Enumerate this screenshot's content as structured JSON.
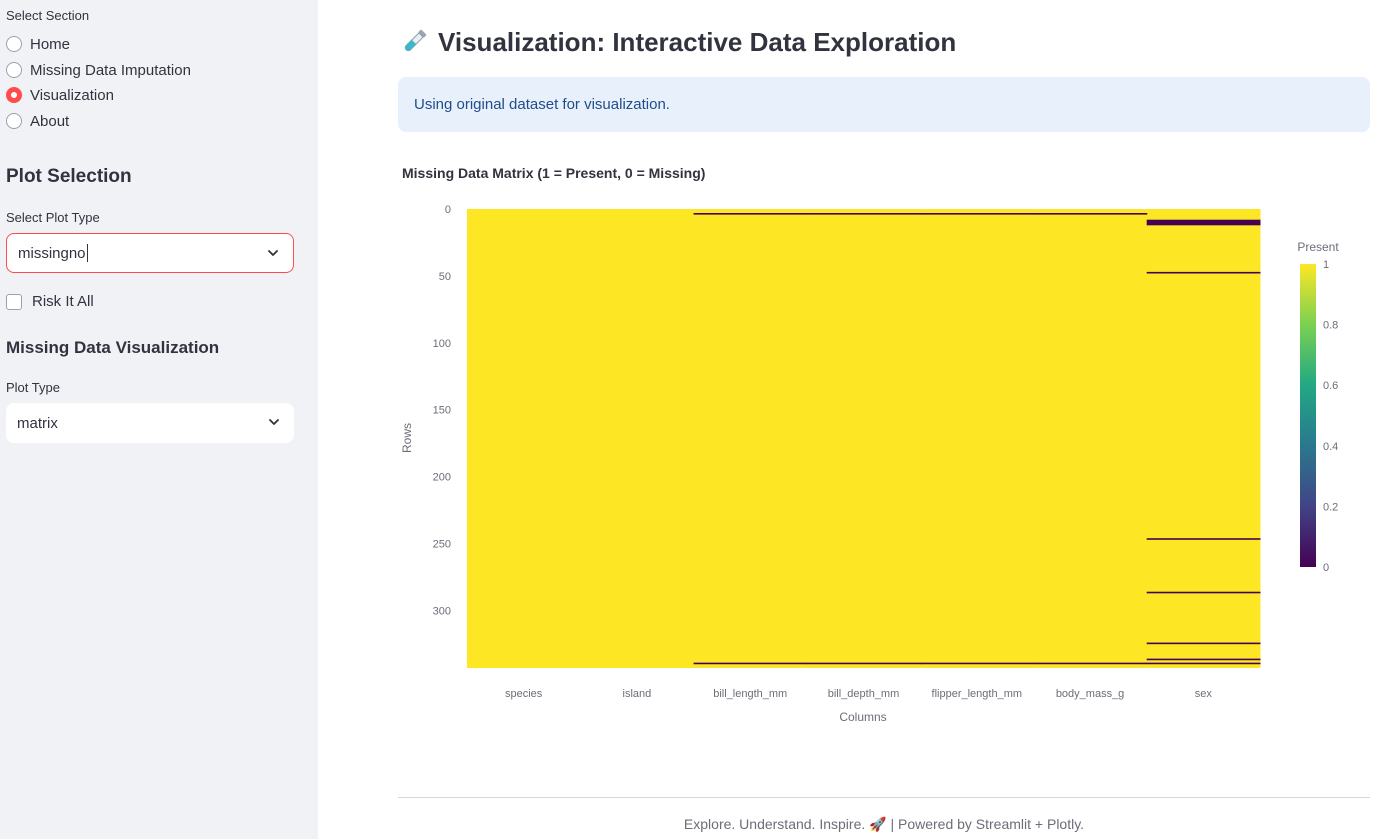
{
  "sidebar": {
    "section_label": "Select Section",
    "sections": [
      {
        "label": "Home",
        "selected": false
      },
      {
        "label": "Missing Data Imputation",
        "selected": false
      },
      {
        "label": "Visualization",
        "selected": true
      },
      {
        "label": "About",
        "selected": false
      }
    ],
    "plot_selection_heading": "Plot Selection",
    "plot_type_label": "Select Plot Type",
    "plot_type_value": "missingno",
    "risk_label": "Risk It All",
    "risk_checked": false,
    "missing_viz_heading": "Missing Data Visualization",
    "missing_plot_label": "Plot Type",
    "missing_plot_value": "matrix"
  },
  "main": {
    "title": "Visualization: Interactive Data Exploration",
    "title_icon": "test-tube-icon",
    "info_text": "Using original dataset for visualization.",
    "footer_text": "Explore. Understand. Inspire. 🚀 | Powered by Streamlit + Plotly."
  },
  "colors": {
    "accent": "#ff4b4b",
    "present": "#fde725",
    "missing": "#440154"
  },
  "chart_data": {
    "type": "heatmap",
    "title": "Missing Data Matrix (1 = Present, 0 = Missing)",
    "xlabel": "Columns",
    "ylabel": "Rows",
    "categories": [
      "species",
      "island",
      "bill_length_mm",
      "bill_depth_mm",
      "flipper_length_mm",
      "body_mass_g",
      "sex"
    ],
    "y_ticks": [
      0,
      50,
      100,
      150,
      200,
      250,
      300
    ],
    "y_range": [
      0,
      343
    ],
    "colorbar_title": "Present",
    "colorbar_ticks": [
      0,
      0.2,
      0.4,
      0.6,
      0.8,
      1
    ],
    "colorscale": "viridis",
    "missing_cells": {
      "bill_length_mm": [
        3,
        339
      ],
      "bill_depth_mm": [
        3,
        339
      ],
      "flipper_length_mm": [
        3,
        339
      ],
      "body_mass_g": [
        3,
        339
      ],
      "sex": [
        8,
        9,
        10,
        11,
        47,
        246,
        286,
        324,
        336,
        339
      ]
    }
  }
}
